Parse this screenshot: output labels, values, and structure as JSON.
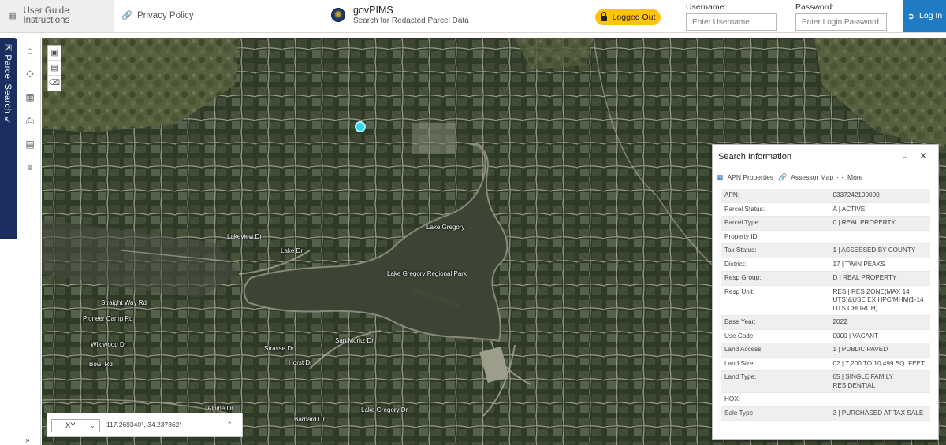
{
  "header": {
    "guide_label": "User Guide Instructions",
    "privacy_label": "Privacy Policy",
    "app_title": "govPIMS",
    "app_subtitle": "Search for Redacted Parcel Data",
    "status_badge": "Logged Out",
    "username_label": "Username:",
    "username_placeholder": "Enter Username",
    "password_label": "Password:",
    "password_placeholder": "Enter Login Password",
    "login_label": "Log In"
  },
  "sidebar": {
    "tab_label": "Parcel Search",
    "tools": [
      "home-icon",
      "layers-icon",
      "grid-icon",
      "print-icon",
      "calculator-icon",
      "list-icon"
    ]
  },
  "map": {
    "labels": {
      "lake": "Lake Gregory",
      "park": "Lake Gregory Regional Park",
      "lakeview": "Lakeview Dr",
      "lake_dr": "Lake Dr",
      "straight_way": "Straight Way Rd",
      "pioneer_camp": "Pioneer Camp Rd",
      "wildwood": "Wildwood Dr",
      "bowl": "Bowl Rd",
      "alpine": "Alpine Dr",
      "barnard": "Barnard Dr",
      "gregory_rd": "Lake Gregory Dr",
      "san_moritz": "San Moritz Dr",
      "horst": "Horst Dr",
      "strasse": "Strasse Dr"
    },
    "coord": {
      "system": "XY",
      "value": "-117.269340°, 34.237862°"
    },
    "marker_color": "#35d6e8"
  },
  "panel": {
    "title": "Search Information",
    "tabs": [
      "APN Properties",
      "Assessor Map",
      "More"
    ],
    "rows": [
      {
        "k": "APN:",
        "v": "0337242100000"
      },
      {
        "k": "Parcel Status:",
        "v": "A | ACTIVE"
      },
      {
        "k": "Parcel Type:",
        "v": "0 | REAL PROPERTY"
      },
      {
        "k": "Property ID:",
        "v": ""
      },
      {
        "k": "Tax Status:",
        "v": "1 | ASSESSED BY COUNTY"
      },
      {
        "k": "District:",
        "v": "17 | TWIN PEAKS"
      },
      {
        "k": "Resp Group:",
        "v": "D | REAL PROPERTY"
      },
      {
        "k": "Resp Unit:",
        "v": "RES | RES ZONE(MAX 14 UTS)&USE EX HPC/MHM(1-14 UTS,CHURCH)"
      },
      {
        "k": "Base Year:",
        "v": "2022"
      },
      {
        "k": "Use Code:",
        "v": "0000 | VACANT"
      },
      {
        "k": "Land Access:",
        "v": "1 | PUBLIC PAVED"
      },
      {
        "k": "Land Size:",
        "v": "02 | 7,200 TO 10,499 SQ. FEET"
      },
      {
        "k": "Land Type:",
        "v": "05 | SINGLE FAMILY RESIDENTIAL"
      },
      {
        "k": "HOX:",
        "v": ""
      },
      {
        "k": "Sale Type:",
        "v": "3 | PURCHASED AT TAX SALE"
      }
    ]
  },
  "colors": {
    "accent_blue": "#1f7bc4",
    "nav_dark": "#1b2e5e",
    "badge_yellow": "#ffc20e"
  }
}
